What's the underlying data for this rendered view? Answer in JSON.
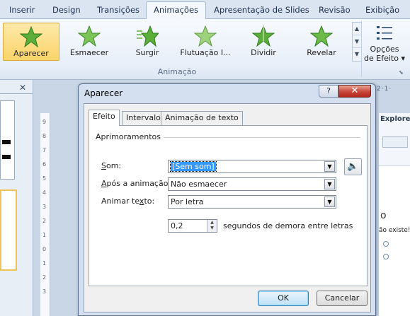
{
  "ribbon_tabs": [
    {
      "label": "Inserir"
    },
    {
      "label": "Design"
    },
    {
      "label": "Transições"
    },
    {
      "label": "Animações"
    },
    {
      "label": "Apresentação de Slides"
    },
    {
      "label": "Revisão"
    },
    {
      "label": "Exibição"
    }
  ],
  "active_tab": "Animações",
  "animations": [
    {
      "label": "Aparecer",
      "icon": "star-icon",
      "selected": true
    },
    {
      "label": "Esmaecer",
      "icon": "star-icon"
    },
    {
      "label": "Surgir",
      "icon": "star-motion-icon"
    },
    {
      "label": "Flutuação I...",
      "icon": "star-icon"
    },
    {
      "label": "Dividir",
      "icon": "star-icon"
    },
    {
      "label": "Revelar",
      "icon": "star-icon"
    }
  ],
  "group_label": "Animação",
  "effect_options": {
    "line1": "Opções",
    "line2": "de Efeito",
    "caret": "▾"
  },
  "ruler_numbers": [
    "9",
    "8",
    "7",
    "6",
    "5",
    "4",
    "3",
    "2",
    "1",
    "0",
    "1",
    "2",
    "3"
  ],
  "ruler_top_fragment": "2·1·",
  "right_panel": {
    "title": "Explorer",
    "text_fragment": "ão existe!",
    "big_letter": "o"
  },
  "dialog": {
    "title": "Aparecer",
    "help": "?",
    "close": "✕",
    "tabs": [
      {
        "label": "Efeito",
        "active": true
      },
      {
        "label": "Intervalo"
      },
      {
        "label": "Animação de texto"
      }
    ],
    "section_title": "Aprimoramentos",
    "fields": {
      "sound": {
        "label_u": "S",
        "label_rest": "om:",
        "value": "[Sem som]"
      },
      "after": {
        "label_u": "A",
        "label_rest": "pós a animação:",
        "value": "Não esmaecer"
      },
      "animate_text": {
        "label_pre": "Animar te",
        "label_u": "x",
        "label_rest": "to:",
        "value": "Por letra"
      },
      "delay": {
        "value": "0,2",
        "suffix": "segundos de demora entre letras"
      }
    },
    "ok": "OK",
    "cancel": "Cancelar"
  },
  "colors": {
    "accent": "#3399ff",
    "star_green": "#5cae3a",
    "close_red": "#c7463a"
  }
}
